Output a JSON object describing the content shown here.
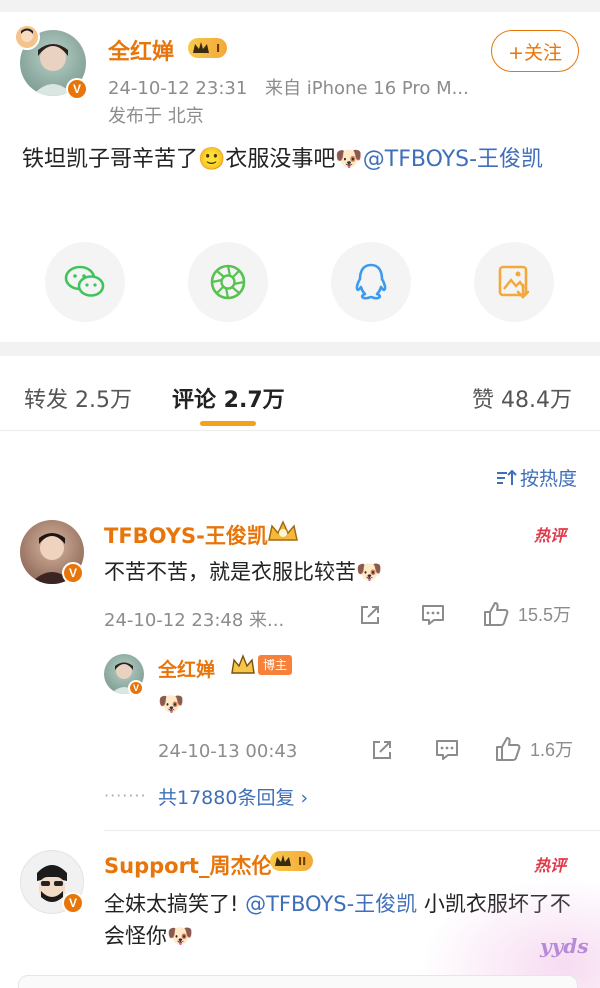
{
  "post": {
    "author": "全红婵",
    "level_badge": "I",
    "follow_label": "+关注",
    "timestamp": "24-10-12 23:31",
    "source": "来自 iPhone 16 Pro M...",
    "location": "发布于 北京",
    "text_main": "铁坦凯子哥辛苦了🙂衣服没事吧🐶",
    "text_mention": "@TFBOYS-王俊凯"
  },
  "share": {
    "items": [
      {
        "icon": "wechat-icon",
        "color": "#3fc35d"
      },
      {
        "icon": "moments-icon",
        "color": "#56c350"
      },
      {
        "icon": "qq-icon",
        "color": "#3c9bf0"
      },
      {
        "icon": "save-image-icon",
        "color": "#f3a83c"
      }
    ]
  },
  "tabs": {
    "repost": "转发 2.5万",
    "comment": "评论 2.7万",
    "like": "赞 48.4万"
  },
  "sort": {
    "label": "按热度"
  },
  "comments": [
    {
      "author": "TFBOYS-王俊凯",
      "hot_tag": "热评",
      "text": "不苦不苦，就是衣服比较苦🐶",
      "timestamp": "24-10-12 23:48 来...",
      "likes": "15.5万",
      "reply": {
        "author": "全红婵",
        "tag": "博主",
        "text": "🐶",
        "timestamp": "24-10-13 00:43",
        "likes": "1.6万"
      },
      "more_replies": "共17880条回复 ›",
      "dots": "·······"
    },
    {
      "author": "Support_周杰伦",
      "level_badge": "II",
      "hot_tag": "热评",
      "text_before": "全妹太搞笑了! ",
      "text_mention": "@TFBOYS-王俊凯",
      "text_after": " 小凯衣服坏了不会怪你🐶"
    }
  ],
  "watermark": "yyds",
  "colors": {
    "accent": "#e8750a",
    "link": "#3f6fb8",
    "hot": "#e03a4a",
    "tab_underline": "#f3a31b"
  }
}
